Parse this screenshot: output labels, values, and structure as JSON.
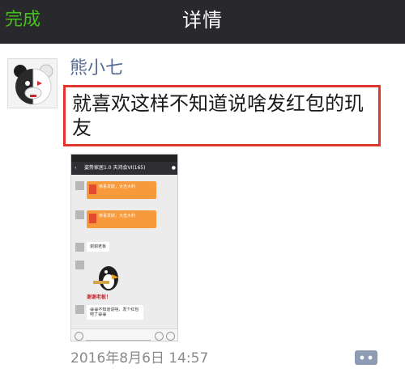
{
  "navbar": {
    "done_label": "完成",
    "title": "详情"
  },
  "post": {
    "author": "熊小七",
    "text": "就喜欢这样不知道说啥发红包的玑友",
    "timestamp": "2016年8月6日 14:57"
  },
  "embedded_screenshot": {
    "chat_title": "姿势家居1.0  天鸿会VI(165)",
    "red_packet_1_text": "恭喜发财，大吉大利",
    "red_packet_2_text": "恭喜发财，大吉大利",
    "bubble_1_text": "谢谢老板",
    "sticker_caption": "谢谢老板！",
    "bubble_2_text": "😀😀不知道说啥，发个红包吧了😀😀",
    "colors": {
      "red_packet": "#f79a3b",
      "envelope": "#e34b2f"
    }
  },
  "colors": {
    "navbar_bg": "#28282d",
    "done": "#45c01a",
    "author": "#576b95",
    "highlight_border": "#e0362c"
  },
  "icons": {
    "comment": "comment-icon"
  }
}
